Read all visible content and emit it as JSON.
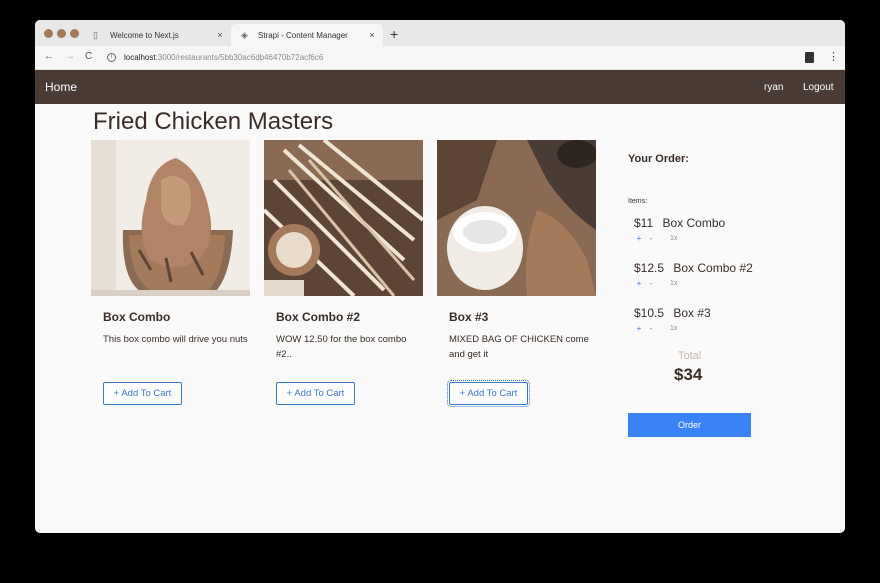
{
  "browser": {
    "tabs": [
      {
        "title": "Welcome to Next.js",
        "close": "×"
      },
      {
        "title": "Strapi - Content Manager",
        "close": "×"
      }
    ],
    "new_tab": "+",
    "nav": {
      "back": "←",
      "forward": "→",
      "reload": "C"
    },
    "url_host": "localhost",
    "url_path": ":3000/restaurants/5bb30ac6db46470b72acf6c6",
    "menu": "⋮"
  },
  "site": {
    "brand": "Home",
    "user": "ryan",
    "logout": "Logout"
  },
  "page": {
    "title": "Fried Chicken Masters"
  },
  "dishes": [
    {
      "name": "Box Combo",
      "description": "This box combo will drive you nuts",
      "button": "+ Add To Cart"
    },
    {
      "name": "Box Combo #2",
      "description": "WOW 12.50 for the box combo #2..",
      "button": "+ Add To Cart"
    },
    {
      "name": "Box #3",
      "description": "MIXED BAG OF CHICKEN come and get it",
      "button": "+ Add To Cart"
    }
  ],
  "order": {
    "title": "Your Order:",
    "items_label": "Items:",
    "items": [
      {
        "price": "$11",
        "name": "Box Combo",
        "plus": "+",
        "minus": "-",
        "qty": "1x"
      },
      {
        "price": "$12.5",
        "name": "Box Combo #2",
        "plus": "+",
        "minus": "-",
        "qty": "1x"
      },
      {
        "price": "$10.5",
        "name": "Box #3",
        "plus": "+",
        "minus": "-",
        "qty": "1x"
      }
    ],
    "total_label": "Total",
    "total": "$34",
    "button": "Order"
  },
  "colors": {
    "navbar": "#4b3b35",
    "accent": "#3b82f6",
    "link": "#3b78c8"
  }
}
